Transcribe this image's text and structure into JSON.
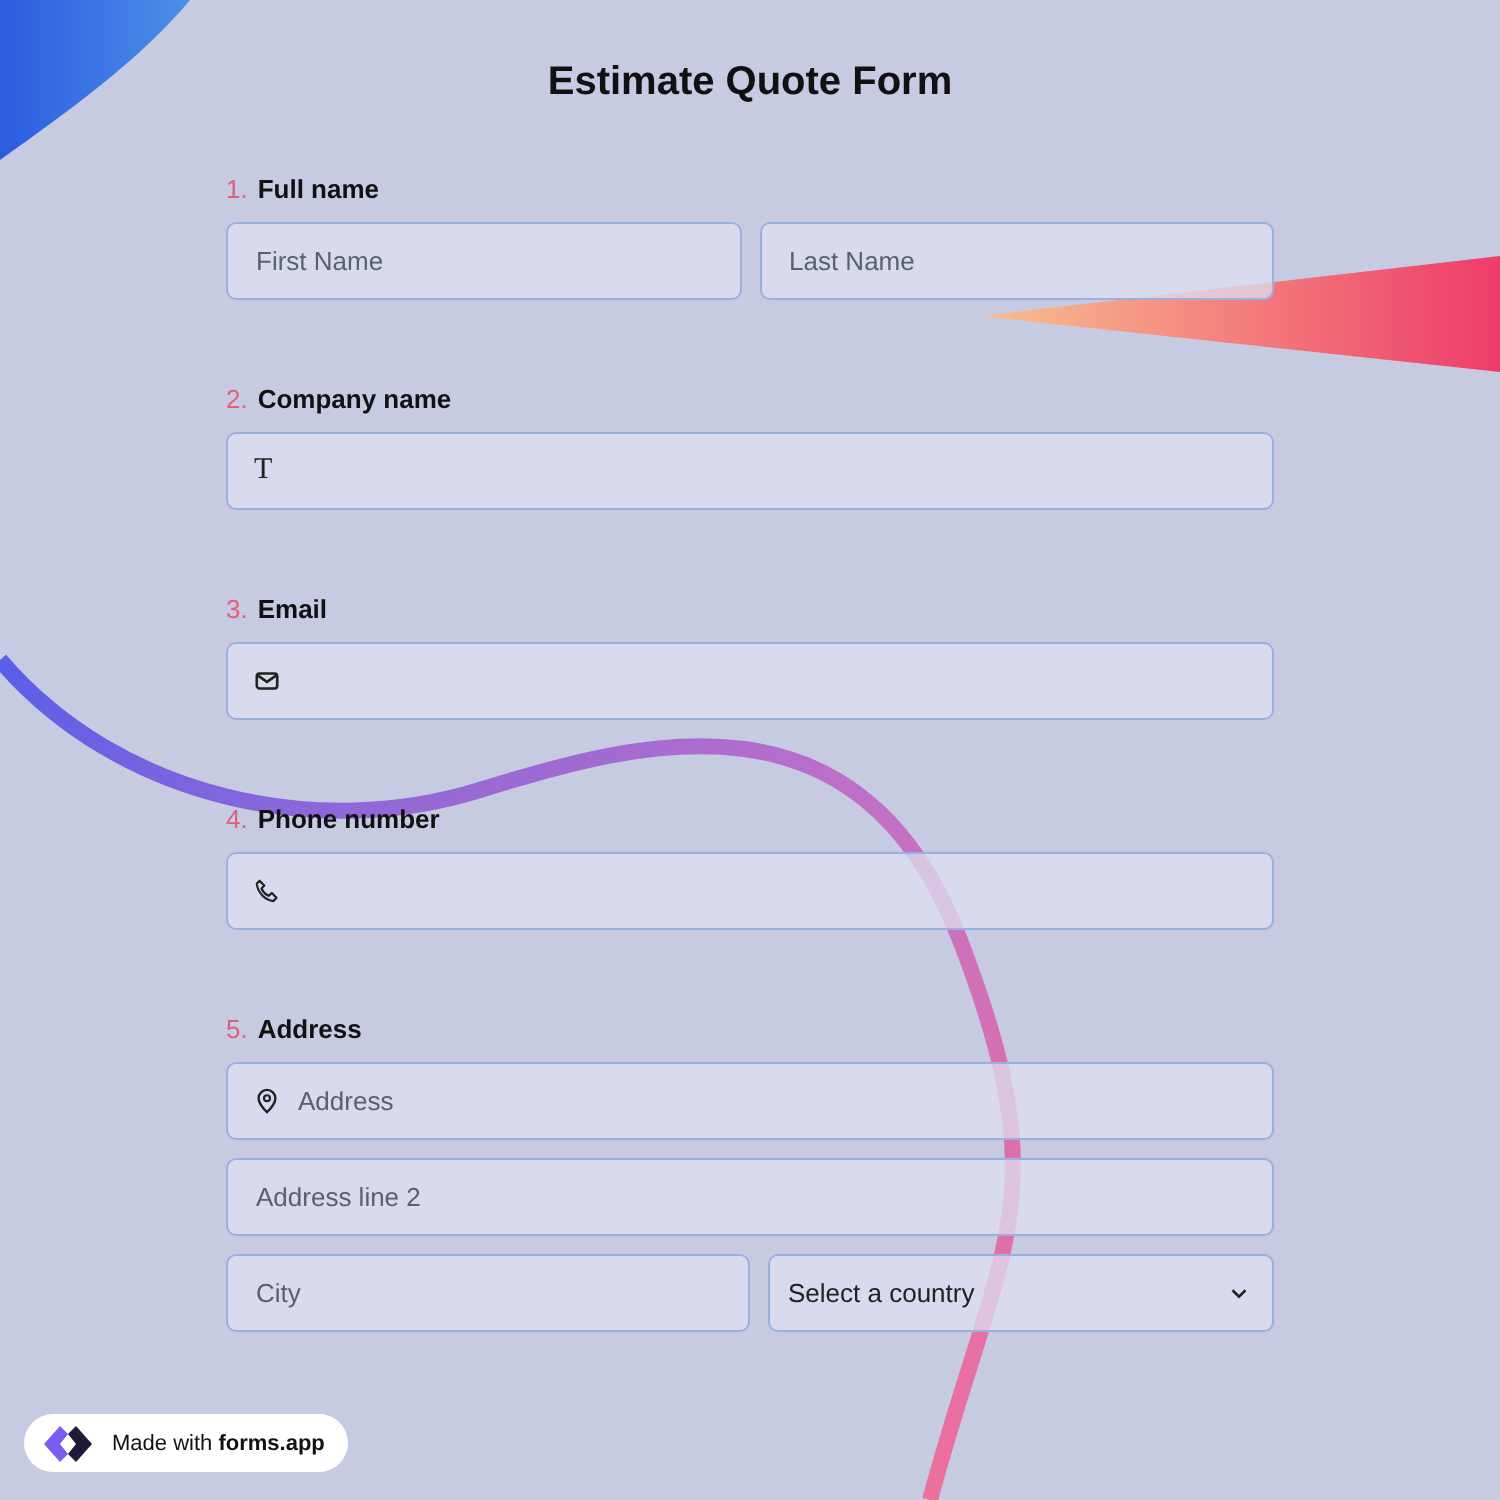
{
  "title": "Estimate Quote Form",
  "questions": [
    {
      "number": "1.",
      "label": "Full name",
      "rows": [
        [
          {
            "kind": "text",
            "placeholder": "First Name"
          },
          {
            "kind": "text",
            "placeholder": "Last Name"
          }
        ]
      ]
    },
    {
      "number": "2.",
      "label": "Company name",
      "rows": [
        [
          {
            "kind": "glyph",
            "icon": "T"
          }
        ]
      ]
    },
    {
      "number": "3.",
      "label": "Email",
      "rows": [
        [
          {
            "kind": "email"
          }
        ]
      ]
    },
    {
      "number": "4.",
      "label": "Phone number",
      "rows": [
        [
          {
            "kind": "phone"
          }
        ]
      ]
    },
    {
      "number": "5.",
      "label": "Address",
      "rows": [
        [
          {
            "kind": "location",
            "placeholder": "Address"
          }
        ],
        [
          {
            "kind": "text",
            "placeholder": "Address line 2"
          }
        ],
        [
          {
            "kind": "text",
            "placeholder": "City"
          },
          {
            "kind": "select",
            "value": "Select a country"
          }
        ]
      ]
    }
  ],
  "badge": {
    "text": "Made with **forms.app**"
  }
}
